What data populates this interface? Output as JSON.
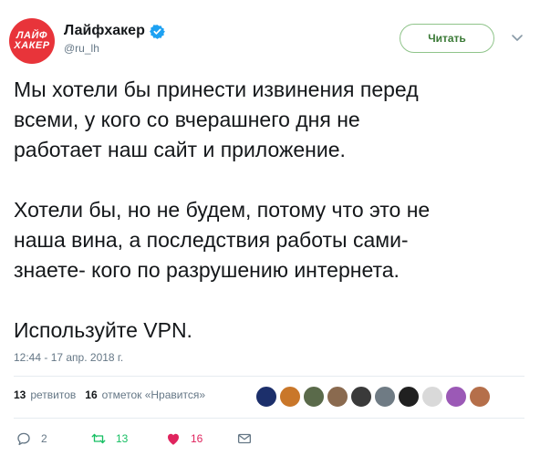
{
  "account": {
    "avatar_line1": "ЛАЙФ",
    "avatar_line2": "ХАКЕР",
    "name": "Лайфхакер",
    "handle": "@ru_lh"
  },
  "follow_button_label": "Читать",
  "tweet": {
    "text": "Мы хотели бы принести извинения перед\nвсеми, у кого со вчерашнего дня не\nработает наш сайт и приложение.\n\nХотели бы, но не будем, потому что это не\nнаша вина, а последствия работы сами-\nзнаете- кого по разрушению интернета.\n\nИспользуйте VPN.",
    "timestamp": "12:44 - 17 апр. 2018 г."
  },
  "stats": {
    "retweets_count": "13",
    "retweets_label": "ретвитов",
    "likes_count": "16",
    "likes_label": "отметок «Нравится»"
  },
  "likers_colors": [
    "#1c2f6b",
    "#c9772a",
    "#5a6a4a",
    "#8a6a4f",
    "#3a3a3a",
    "#6f7b84",
    "#202020",
    "#d9d9d9",
    "#9b59b6",
    "#b56f4a"
  ],
  "actions": {
    "replies": "2",
    "retweets": "13",
    "likes": "16"
  },
  "colors": {
    "brand_red": "#e8343a",
    "verified_blue": "#1da1f2",
    "retweet_green": "#17bf63",
    "like_red": "#e0245e",
    "muted": "#657786"
  }
}
